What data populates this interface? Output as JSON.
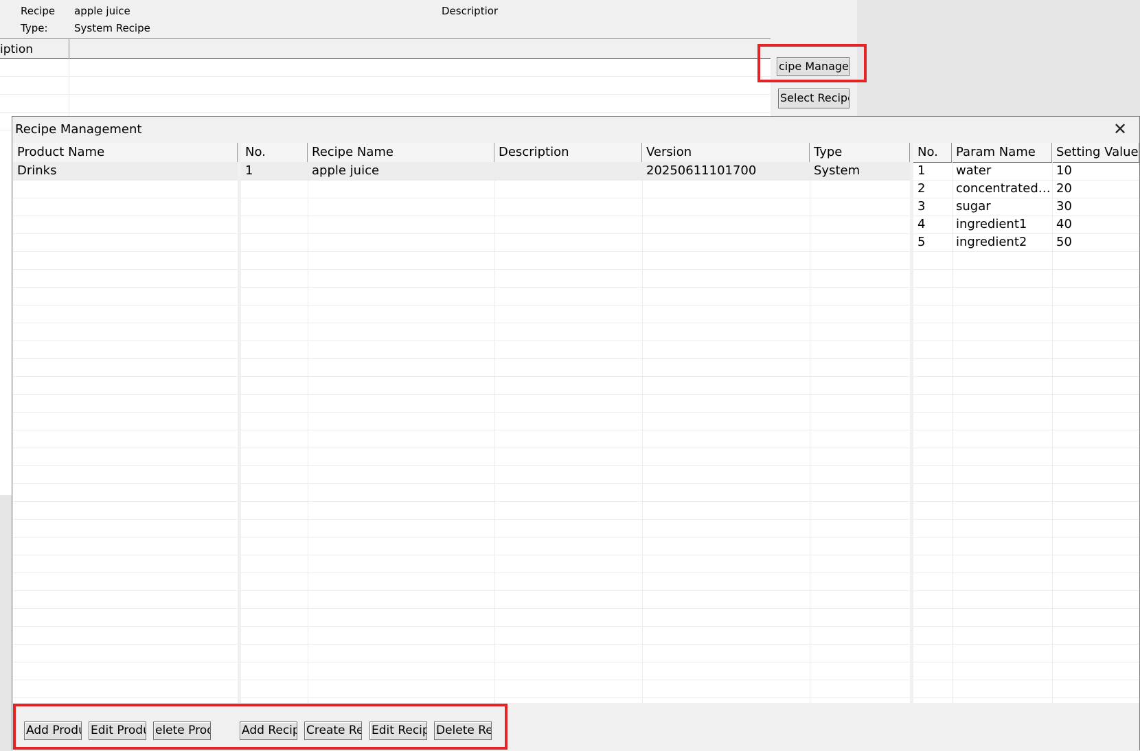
{
  "background": {
    "recipe_label": "Recipe",
    "recipe_value": "apple juice",
    "type_label": "Type:",
    "type_value": "System Recipe",
    "description_label": "Descriptior",
    "grid_header": "iption",
    "recipe_management_button": "cipe Manageme",
    "select_recipe_button": "Select Recipe"
  },
  "dialog": {
    "title": "Recipe Management",
    "close_icon": "close-icon",
    "products": {
      "headers": [
        "Product Name"
      ],
      "rows": [
        [
          "Drinks"
        ]
      ]
    },
    "recipes": {
      "headers": [
        "No.",
        "Recipe Name",
        "Description",
        "Version",
        "Type"
      ],
      "rows": [
        [
          "1",
          "apple juice",
          "",
          "20250611101700",
          "System"
        ]
      ]
    },
    "params": {
      "headers": [
        "No.",
        "Param Name",
        "Setting Value"
      ],
      "rows": [
        [
          "1",
          "water",
          "10"
        ],
        [
          "2",
          "concentrated s...",
          "20"
        ],
        [
          "3",
          "sugar",
          "30"
        ],
        [
          "4",
          "ingredient1",
          "40"
        ],
        [
          "5",
          "ingredient2",
          "50"
        ]
      ]
    },
    "buttons": {
      "add_product": "Add Produc",
      "edit_product": "Edit Product",
      "delete_product": "elete Produ",
      "add_recipe": "Add Recipe",
      "create_recipe": "Create Recip",
      "edit_recipe": "Edit Recipe",
      "delete_recipe": "Delete Recip"
    }
  },
  "colors": {
    "highlight": "#e32424",
    "window_bg": "#f0f0f0",
    "grid_bg": "#ffffff"
  }
}
